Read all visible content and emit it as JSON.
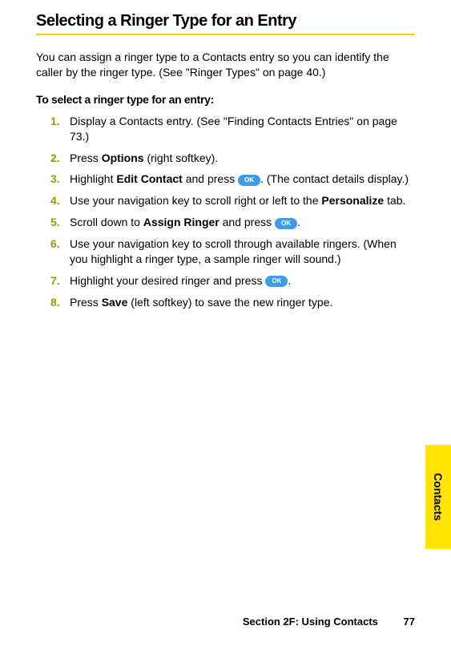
{
  "heading": "Selecting a Ringer Type for an Entry",
  "intro": "You  can assign a ringer type to a Contacts entry so you can identify the caller by the ringer type. (See \"Ringer Types\" on page 40.)",
  "subheading": "To select a ringer type for an entry:",
  "ok_label": "OK",
  "steps": [
    {
      "num": "1.",
      "parts": [
        {
          "t": "Display a Contacts entry. (See \"Finding Contacts Entries\" on page 73.)"
        }
      ]
    },
    {
      "num": "2.",
      "parts": [
        {
          "t": "Press "
        },
        {
          "t": "Options",
          "bold": true
        },
        {
          "t": " (right softkey)."
        }
      ]
    },
    {
      "num": "3.",
      "parts": [
        {
          "t": "Highlight "
        },
        {
          "t": "Edit Contact",
          "bold": true
        },
        {
          "t": " and press "
        },
        {
          "ok": true
        },
        {
          "t": ". (The contact details display.)"
        }
      ]
    },
    {
      "num": "4.",
      "parts": [
        {
          "t": "Use your navigation key to scroll right or left to the "
        },
        {
          "t": "Personalize",
          "bold": true
        },
        {
          "t": " tab."
        }
      ]
    },
    {
      "num": "5.",
      "parts": [
        {
          "t": "Scroll down to "
        },
        {
          "t": "Assign Ringer",
          "bold": true
        },
        {
          "t": " and press "
        },
        {
          "ok": true
        },
        {
          "t": "."
        }
      ]
    },
    {
      "num": "6.",
      "parts": [
        {
          "t": "Use your navigation key to scroll through available ringers. (When you highlight a ringer type, a sample ringer will sound.)"
        }
      ]
    },
    {
      "num": "7.",
      "parts": [
        {
          "t": "Highlight your desired ringer and press "
        },
        {
          "ok": true
        },
        {
          "t": "."
        }
      ]
    },
    {
      "num": "8.",
      "parts": [
        {
          "t": "Press "
        },
        {
          "t": "Save",
          "bold": true
        },
        {
          "t": " (left softkey) to save the new ringer type."
        }
      ]
    }
  ],
  "side_tab": "Contacts",
  "footer_section": "Section 2F: Using Contacts",
  "footer_page": "77"
}
